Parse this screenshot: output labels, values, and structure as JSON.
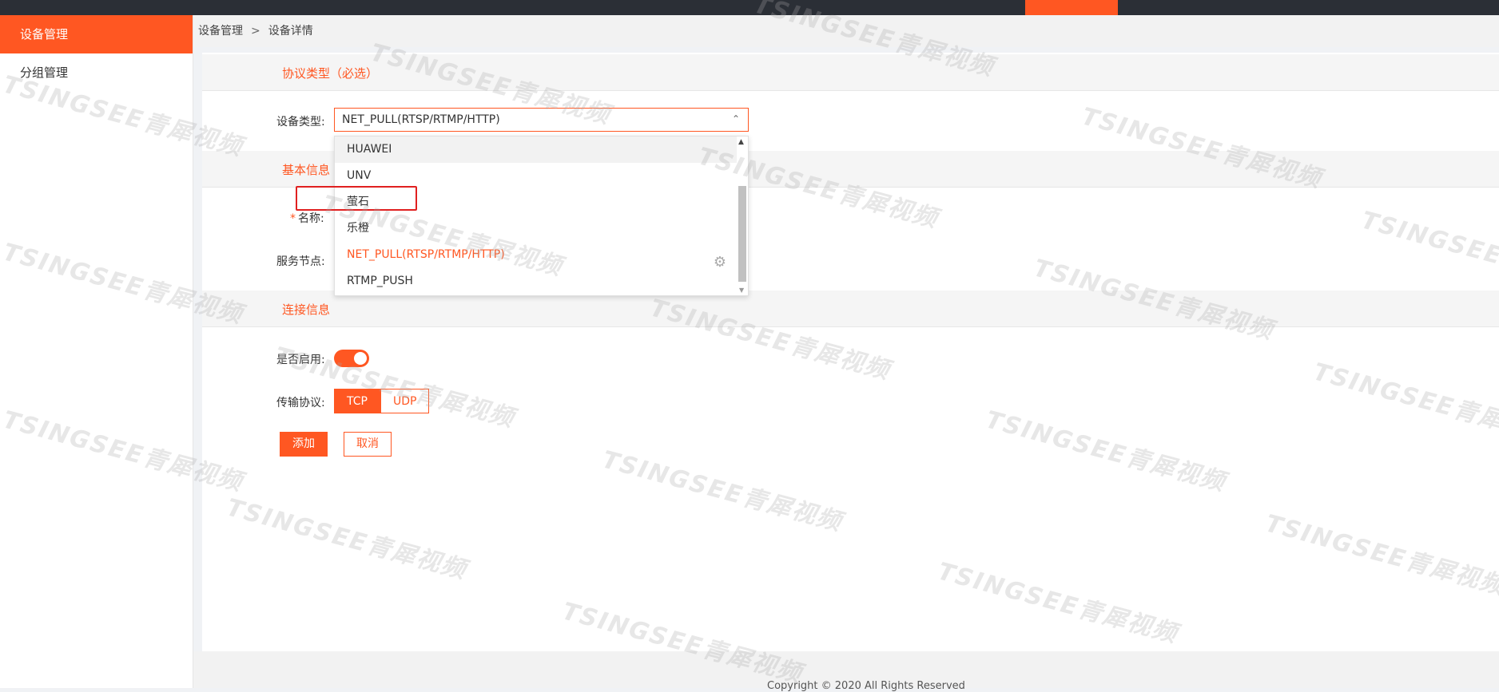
{
  "sidebar": {
    "items": [
      {
        "label": "设备管理",
        "active": true
      },
      {
        "label": "分组管理",
        "active": false
      }
    ]
  },
  "breadcrumb": {
    "items": [
      "设备管理",
      "设备详情"
    ],
    "separator": ">"
  },
  "sections": {
    "protocol": "协议类型（必选）",
    "basic": "基本信息",
    "connection": "连接信息"
  },
  "form": {
    "device_type_label": "设备类型:",
    "device_type_value": "NET_PULL(RTSP/RTMP/HTTP)",
    "name_label": "名称:",
    "name_required": "*",
    "service_node_label": "服务节点:",
    "enabled_label": "是否启用:",
    "enabled": true,
    "transport_label": "传输协议:",
    "transport_options": [
      "TCP",
      "UDP"
    ],
    "transport_selected": "TCP"
  },
  "dropdown": {
    "options": [
      "HUAWEI",
      "UNV",
      "萤石",
      "乐橙",
      "NET_PULL(RTSP/RTMP/HTTP)",
      "RTMP_PUSH"
    ],
    "hovered": "HUAWEI",
    "selected": "NET_PULL(RTSP/RTMP/HTTP)",
    "highlighted": "萤石"
  },
  "buttons": {
    "add": "添加",
    "cancel": "取消"
  },
  "footer": {
    "copyright": "Copyright © 2020 All Rights Reserved"
  },
  "watermark": {
    "text": "TSINGSEE青犀视频"
  },
  "colors": {
    "accent": "#ff5722",
    "topbar": "#2b2f36",
    "highlight": "#e02020"
  }
}
